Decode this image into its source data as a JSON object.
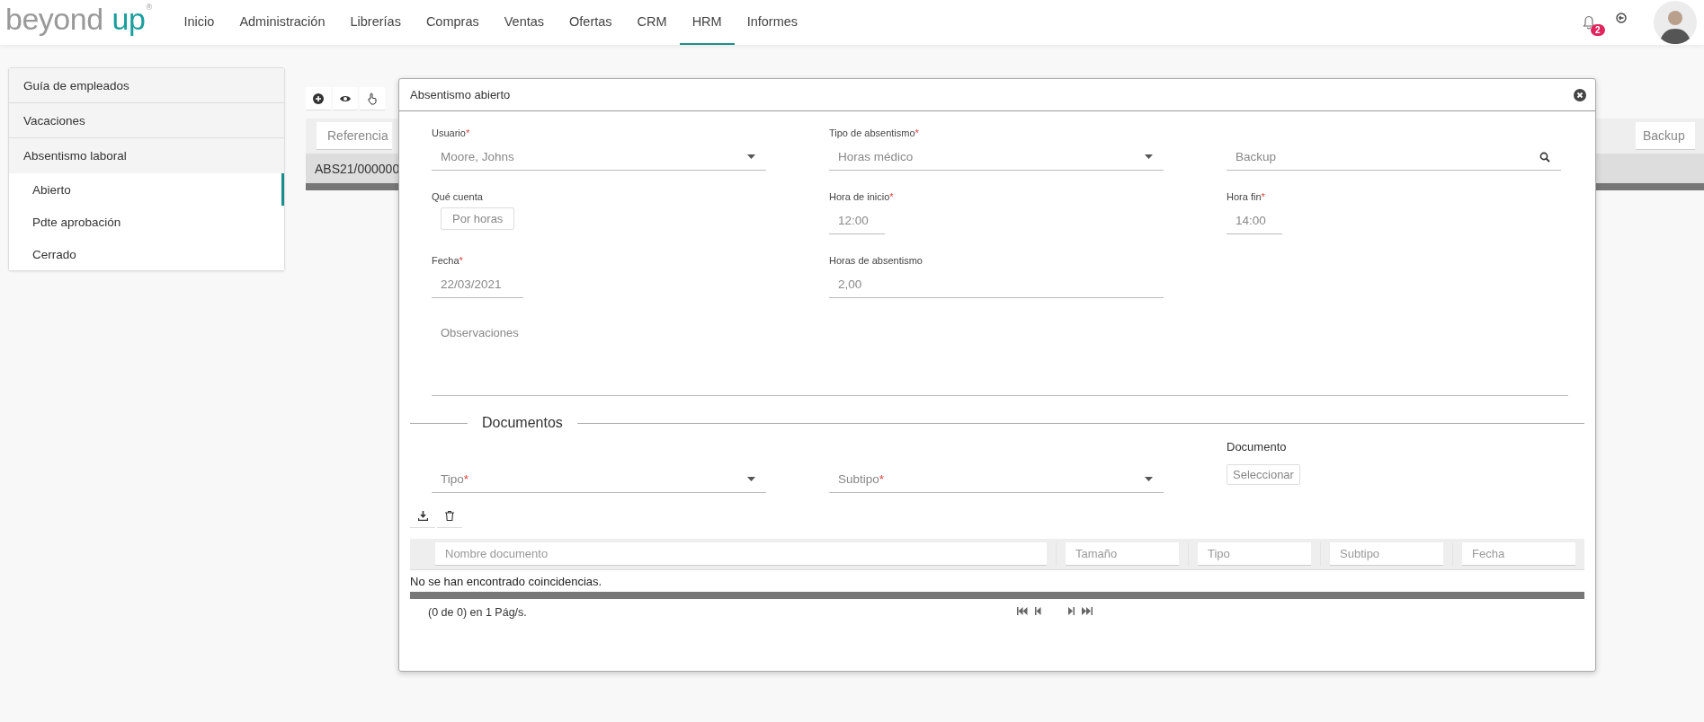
{
  "header": {
    "logo": {
      "word1": "beyond",
      "word2": "up",
      "mark": "®"
    },
    "nav": [
      {
        "label": "Inicio",
        "selected": false
      },
      {
        "label": "Administración",
        "selected": false
      },
      {
        "label": "Librerías",
        "selected": false
      },
      {
        "label": "Compras",
        "selected": false
      },
      {
        "label": "Ventas",
        "selected": false
      },
      {
        "label": "Ofertas",
        "selected": false
      },
      {
        "label": "CRM",
        "selected": false
      },
      {
        "label": "HRM",
        "selected": true
      },
      {
        "label": "Informes",
        "selected": false
      }
    ],
    "notifications": {
      "count": "2"
    }
  },
  "sidebar": {
    "items": [
      {
        "label": "Guía de empleados"
      },
      {
        "label": "Vacaciones"
      },
      {
        "label": "Absentismo laboral",
        "children": [
          {
            "label": "Abierto",
            "selected": true
          },
          {
            "label": "Pdte aprobación",
            "selected": false
          },
          {
            "label": "Cerrado",
            "selected": false
          }
        ]
      }
    ]
  },
  "list": {
    "columns": [
      "Referencia",
      "Backup"
    ],
    "rows": [
      {
        "referencia": "ABS21/000000"
      }
    ]
  },
  "dialog": {
    "title": "Absentismo abierto",
    "fields": [
      {
        "kind": "select",
        "label": "Usuario",
        "marker": "*",
        "value": "Moore, Johns"
      },
      {
        "kind": "select",
        "label": "Tipo de absentismo",
        "marker": "*",
        "value": "Horas médico"
      },
      {
        "kind": "search",
        "placeholder": "Backup"
      },
      {
        "kind": "button",
        "label": "Qué cuenta",
        "value": "Por horas"
      },
      {
        "kind": "short",
        "label": "Hora de inicio",
        "marker": "*",
        "value": "12:00"
      },
      {
        "kind": "short",
        "label": "Hora fin",
        "marker": "*",
        "value": "14:00"
      },
      {
        "kind": "short",
        "label": "Fecha",
        "marker": "*",
        "value": "22/03/2021"
      },
      {
        "kind": "long",
        "label": "Horas de absentismo",
        "value": "2,00"
      }
    ],
    "observations": {
      "placeholder": "Observaciones"
    },
    "documents": {
      "title": "Documentos",
      "fields": [
        {
          "kind": "select",
          "placeholder": "Tipo",
          "marker": "*"
        },
        {
          "kind": "select",
          "placeholder": "Subtipo",
          "marker": "*"
        },
        {
          "kind": "file",
          "label": "Documento",
          "button": "Seleccionar"
        }
      ],
      "table": {
        "columns": [
          "Nombre documento",
          "Tamaño",
          "Tipo",
          "Subtipo",
          "Fecha"
        ],
        "empty": "No se han encontrado coincidencias.",
        "pager": "(0 de 0) en 1 Pág/s."
      }
    }
  }
}
